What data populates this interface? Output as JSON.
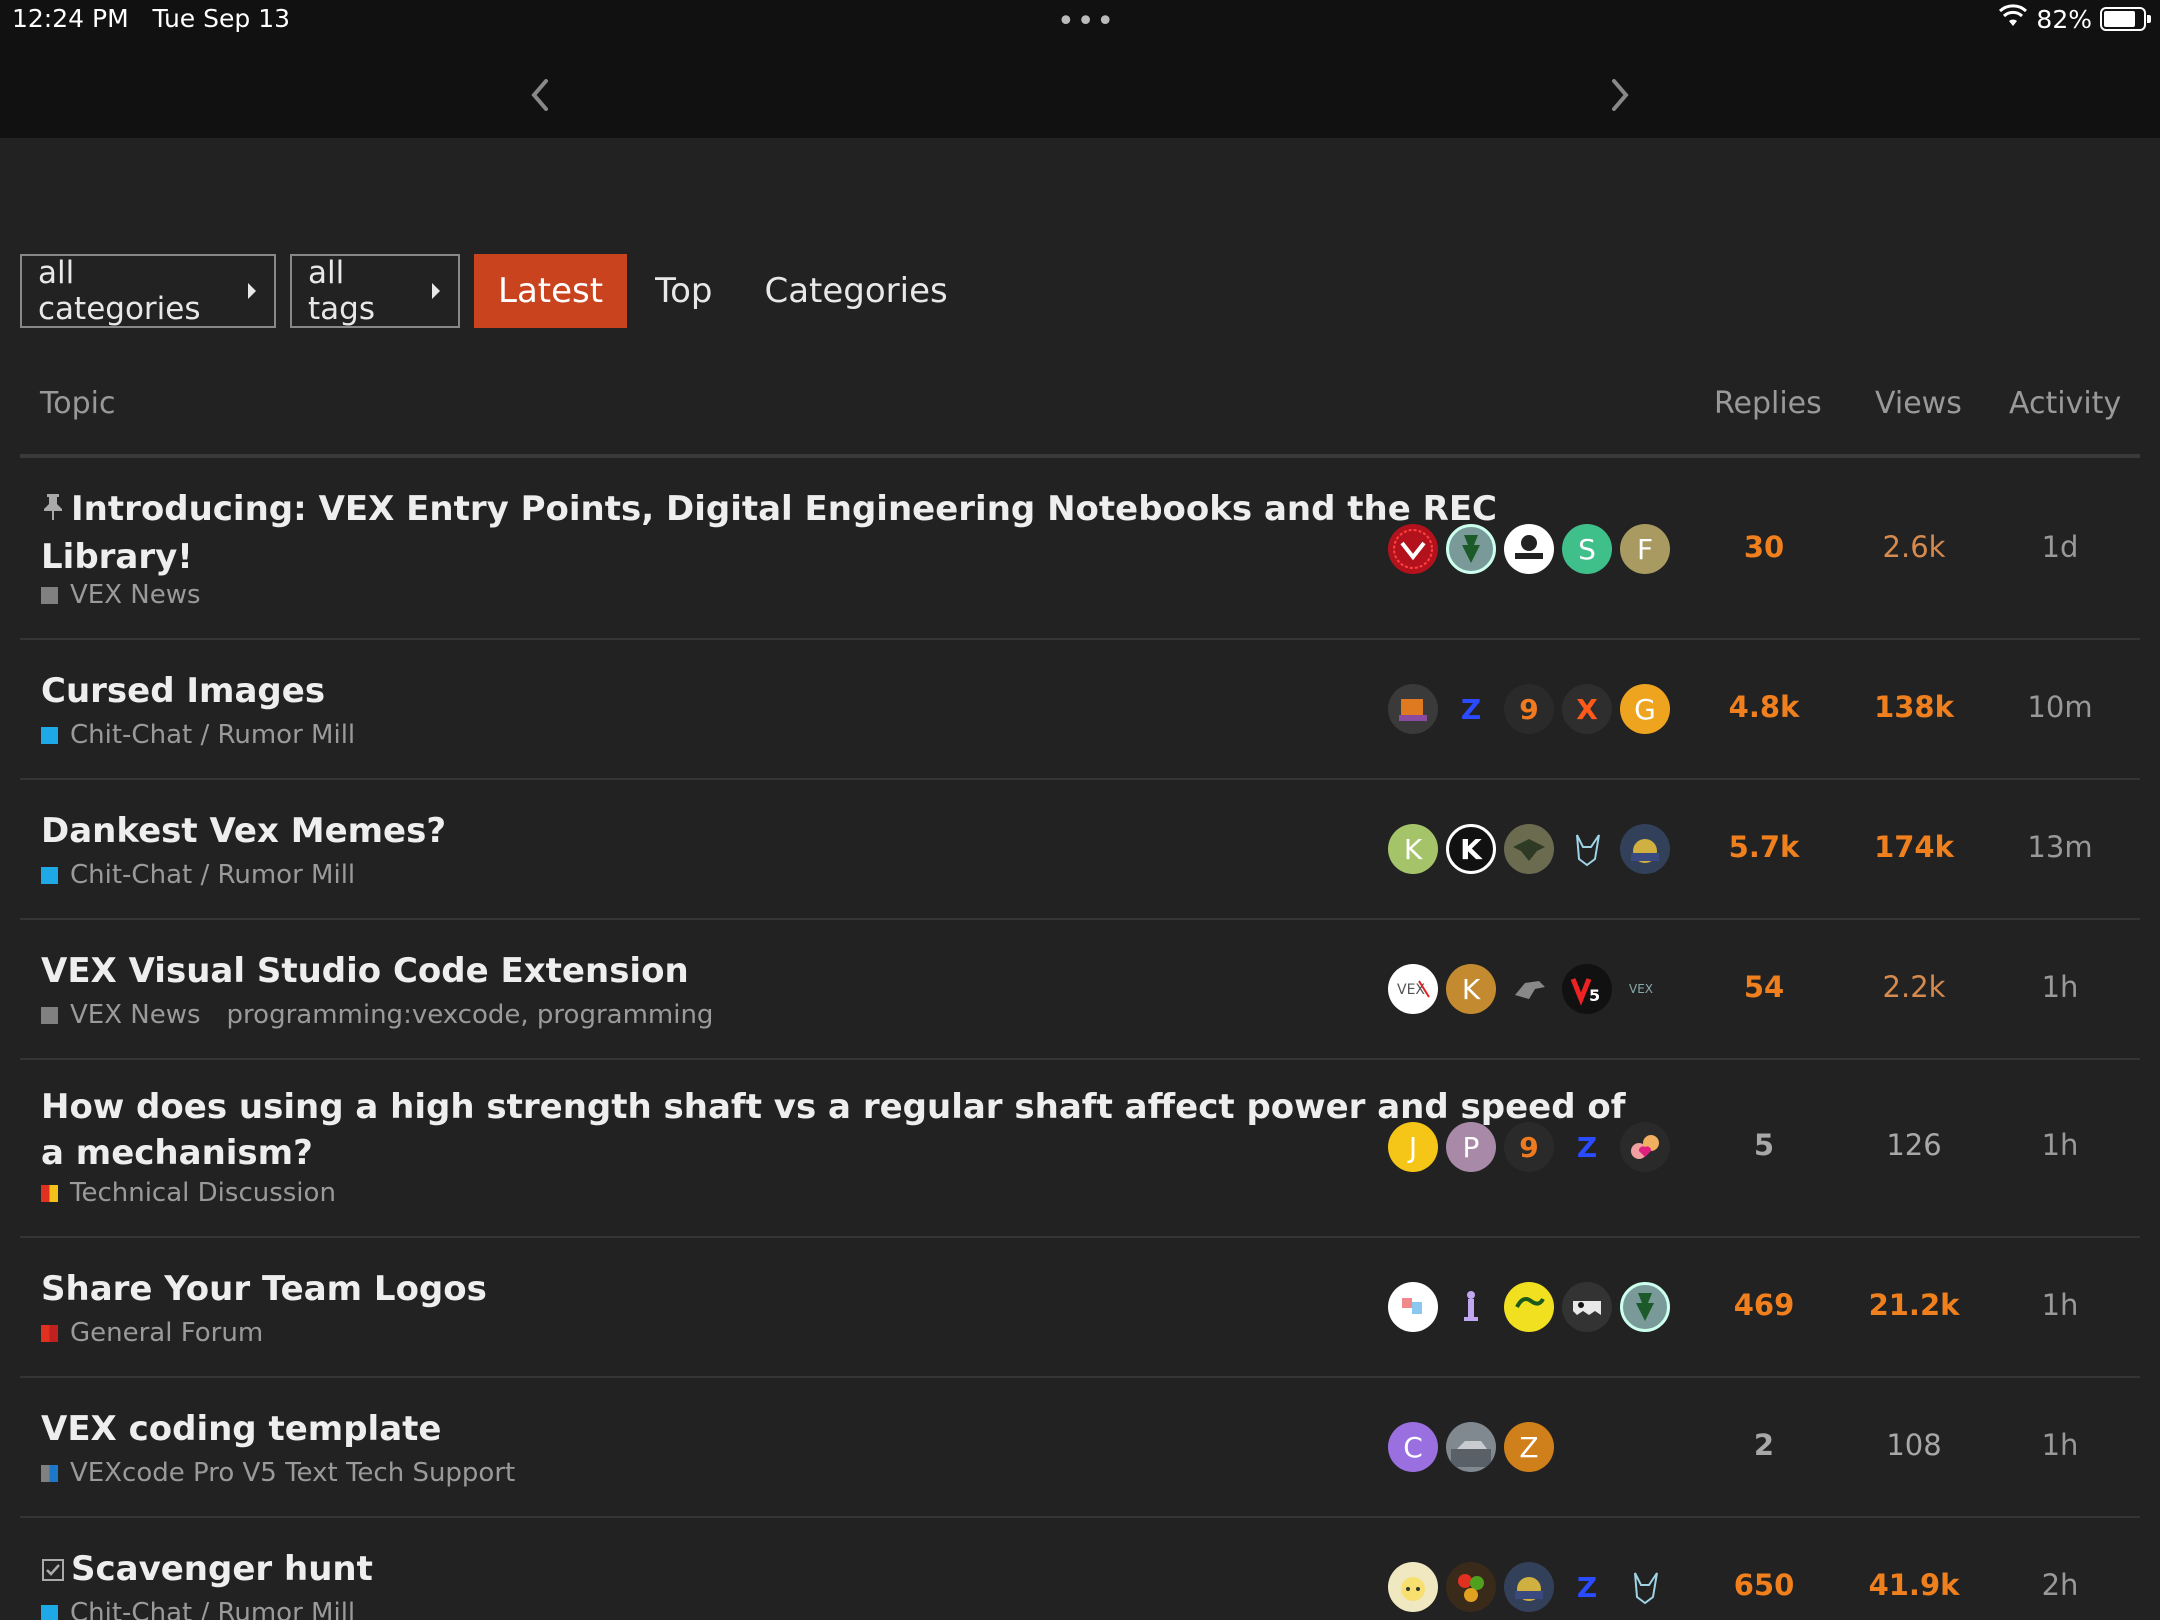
{
  "status_bar": {
    "time": "12:24 PM",
    "date": "Tue Sep 13",
    "dots": "•••",
    "battery": "82%",
    "battery_level": 0.82
  },
  "filters": {
    "categories_dropdown": "all categories",
    "tags_dropdown": "all tags",
    "tabs": [
      "Latest",
      "Top",
      "Categories"
    ],
    "active_tab": "Latest"
  },
  "columns": {
    "topic": "Topic",
    "replies": "Replies",
    "views": "Views",
    "activity": "Activity"
  },
  "colors": {
    "accent": "#c9431f",
    "hot": "#f0801e",
    "background": "#222222"
  },
  "topics": [
    {
      "title_line1": "Introducing: VEX Entry Points, Digital Engineering Notebooks and the REC",
      "title_line2": "Library!",
      "pinned": true,
      "category": "VEX News",
      "tags": "",
      "replies": "30",
      "views": "2.6k",
      "activity": "1d",
      "avatars": [
        "",
        "",
        "",
        "S",
        "F"
      ]
    },
    {
      "title_line1": "Cursed Images",
      "title_line2": "",
      "category": "Chit-Chat / Rumor Mill",
      "tags": "",
      "replies": "4.8k",
      "views": "138k",
      "activity": "10m",
      "avatars": [
        "",
        "Z",
        "9",
        "X",
        "G"
      ]
    },
    {
      "title_line1": "Dankest Vex Memes?",
      "title_line2": "",
      "category": "Chit-Chat / Rumor Mill",
      "tags": "",
      "replies": "5.7k",
      "views": "174k",
      "activity": "13m",
      "avatars": [
        "K",
        "K",
        "",
        "",
        ""
      ]
    },
    {
      "title_line1": "VEX Visual Studio Code Extension",
      "title_line2": "",
      "category": "VEX News",
      "tags": "programming:vexcode,  programming",
      "replies": "54",
      "views": "2.2k",
      "activity": "1h",
      "avatars": [
        "",
        "K",
        "",
        "V5",
        ""
      ]
    },
    {
      "title_line1": "How does using a high strength shaft vs a regular shaft affect power and speed of",
      "title_line2": "a mechanism?",
      "category": "Technical Discussion",
      "tags": "",
      "replies": "5",
      "views": "126",
      "activity": "1h",
      "avatars": [
        "J",
        "P",
        "9",
        "Z",
        ""
      ]
    },
    {
      "title_line1": "Share Your Team Logos",
      "title_line2": "",
      "category": "General Forum",
      "tags": "",
      "replies": "469",
      "views": "21.2k",
      "activity": "1h",
      "avatars": [
        "",
        "",
        "",
        "",
        ""
      ]
    },
    {
      "title_line1": "VEX coding template",
      "title_line2": "",
      "category": "VEXcode Pro V5 Text Tech Support",
      "tags": "",
      "replies": "2",
      "views": "108",
      "activity": "1h",
      "avatars": [
        "C",
        "",
        "Z"
      ]
    },
    {
      "title_line1": "Scavenger hunt",
      "title_line2": "",
      "solved": true,
      "category": "Chit-Chat / Rumor Mill",
      "tags": "",
      "replies": "650",
      "views": "41.9k",
      "activity": "2h",
      "avatars": [
        "",
        "",
        "",
        "Z",
        ""
      ]
    }
  ]
}
